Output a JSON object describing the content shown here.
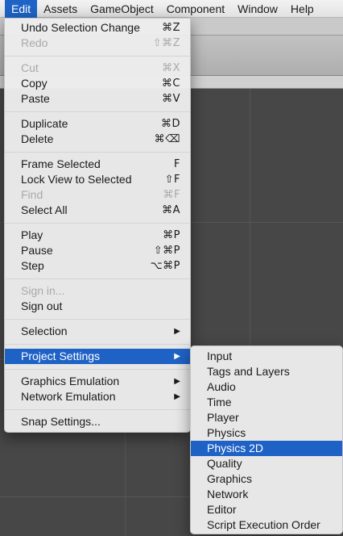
{
  "menubar": {
    "items": [
      "Edit",
      "Assets",
      "GameObject",
      "Component",
      "Window",
      "Help"
    ]
  },
  "edit_menu": {
    "items": [
      {
        "label": "Undo Selection Change",
        "shortcut": "⌘Z",
        "disabled": false
      },
      {
        "label": "Redo",
        "shortcut": "⇧⌘Z",
        "disabled": true
      },
      {
        "label": "Cut",
        "shortcut": "⌘X",
        "disabled": true
      },
      {
        "label": "Copy",
        "shortcut": "⌘C",
        "disabled": false
      },
      {
        "label": "Paste",
        "shortcut": "⌘V",
        "disabled": false
      },
      {
        "label": "Duplicate",
        "shortcut": "⌘D",
        "disabled": false
      },
      {
        "label": "Delete",
        "shortcut": "⌘⌫",
        "disabled": false
      },
      {
        "label": "Frame Selected",
        "shortcut": "F",
        "disabled": false
      },
      {
        "label": "Lock View to Selected",
        "shortcut": "⇧F",
        "disabled": false
      },
      {
        "label": "Find",
        "shortcut": "⌘F",
        "disabled": true
      },
      {
        "label": "Select All",
        "shortcut": "⌘A",
        "disabled": false
      },
      {
        "label": "Play",
        "shortcut": "⌘P",
        "disabled": false
      },
      {
        "label": "Pause",
        "shortcut": "⇧⌘P",
        "disabled": false
      },
      {
        "label": "Step",
        "shortcut": "⌥⌘P",
        "disabled": false
      },
      {
        "label": "Sign in...",
        "shortcut": "",
        "disabled": true
      },
      {
        "label": "Sign out",
        "shortcut": "",
        "disabled": false
      },
      {
        "label": "Selection",
        "shortcut": "▶",
        "disabled": false
      },
      {
        "label": "Project Settings",
        "shortcut": "▶",
        "disabled": false,
        "highlighted": true
      },
      {
        "label": "Graphics Emulation",
        "shortcut": "▶",
        "disabled": false
      },
      {
        "label": "Network Emulation",
        "shortcut": "▶",
        "disabled": false
      },
      {
        "label": "Snap Settings...",
        "shortcut": "",
        "disabled": false
      }
    ]
  },
  "project_settings_menu": {
    "items": [
      {
        "label": "Input"
      },
      {
        "label": "Tags and Layers"
      },
      {
        "label": "Audio"
      },
      {
        "label": "Time"
      },
      {
        "label": "Player"
      },
      {
        "label": "Physics"
      },
      {
        "label": "Physics 2D",
        "highlighted": true
      },
      {
        "label": "Quality"
      },
      {
        "label": "Graphics"
      },
      {
        "label": "Network"
      },
      {
        "label": "Editor"
      },
      {
        "label": "Script Execution Order"
      }
    ]
  },
  "colors": {
    "highlight": "#1f62c6",
    "menu_background": "#ececec",
    "disabled_text": "#a9a9a9",
    "scene_background": "#474747"
  }
}
